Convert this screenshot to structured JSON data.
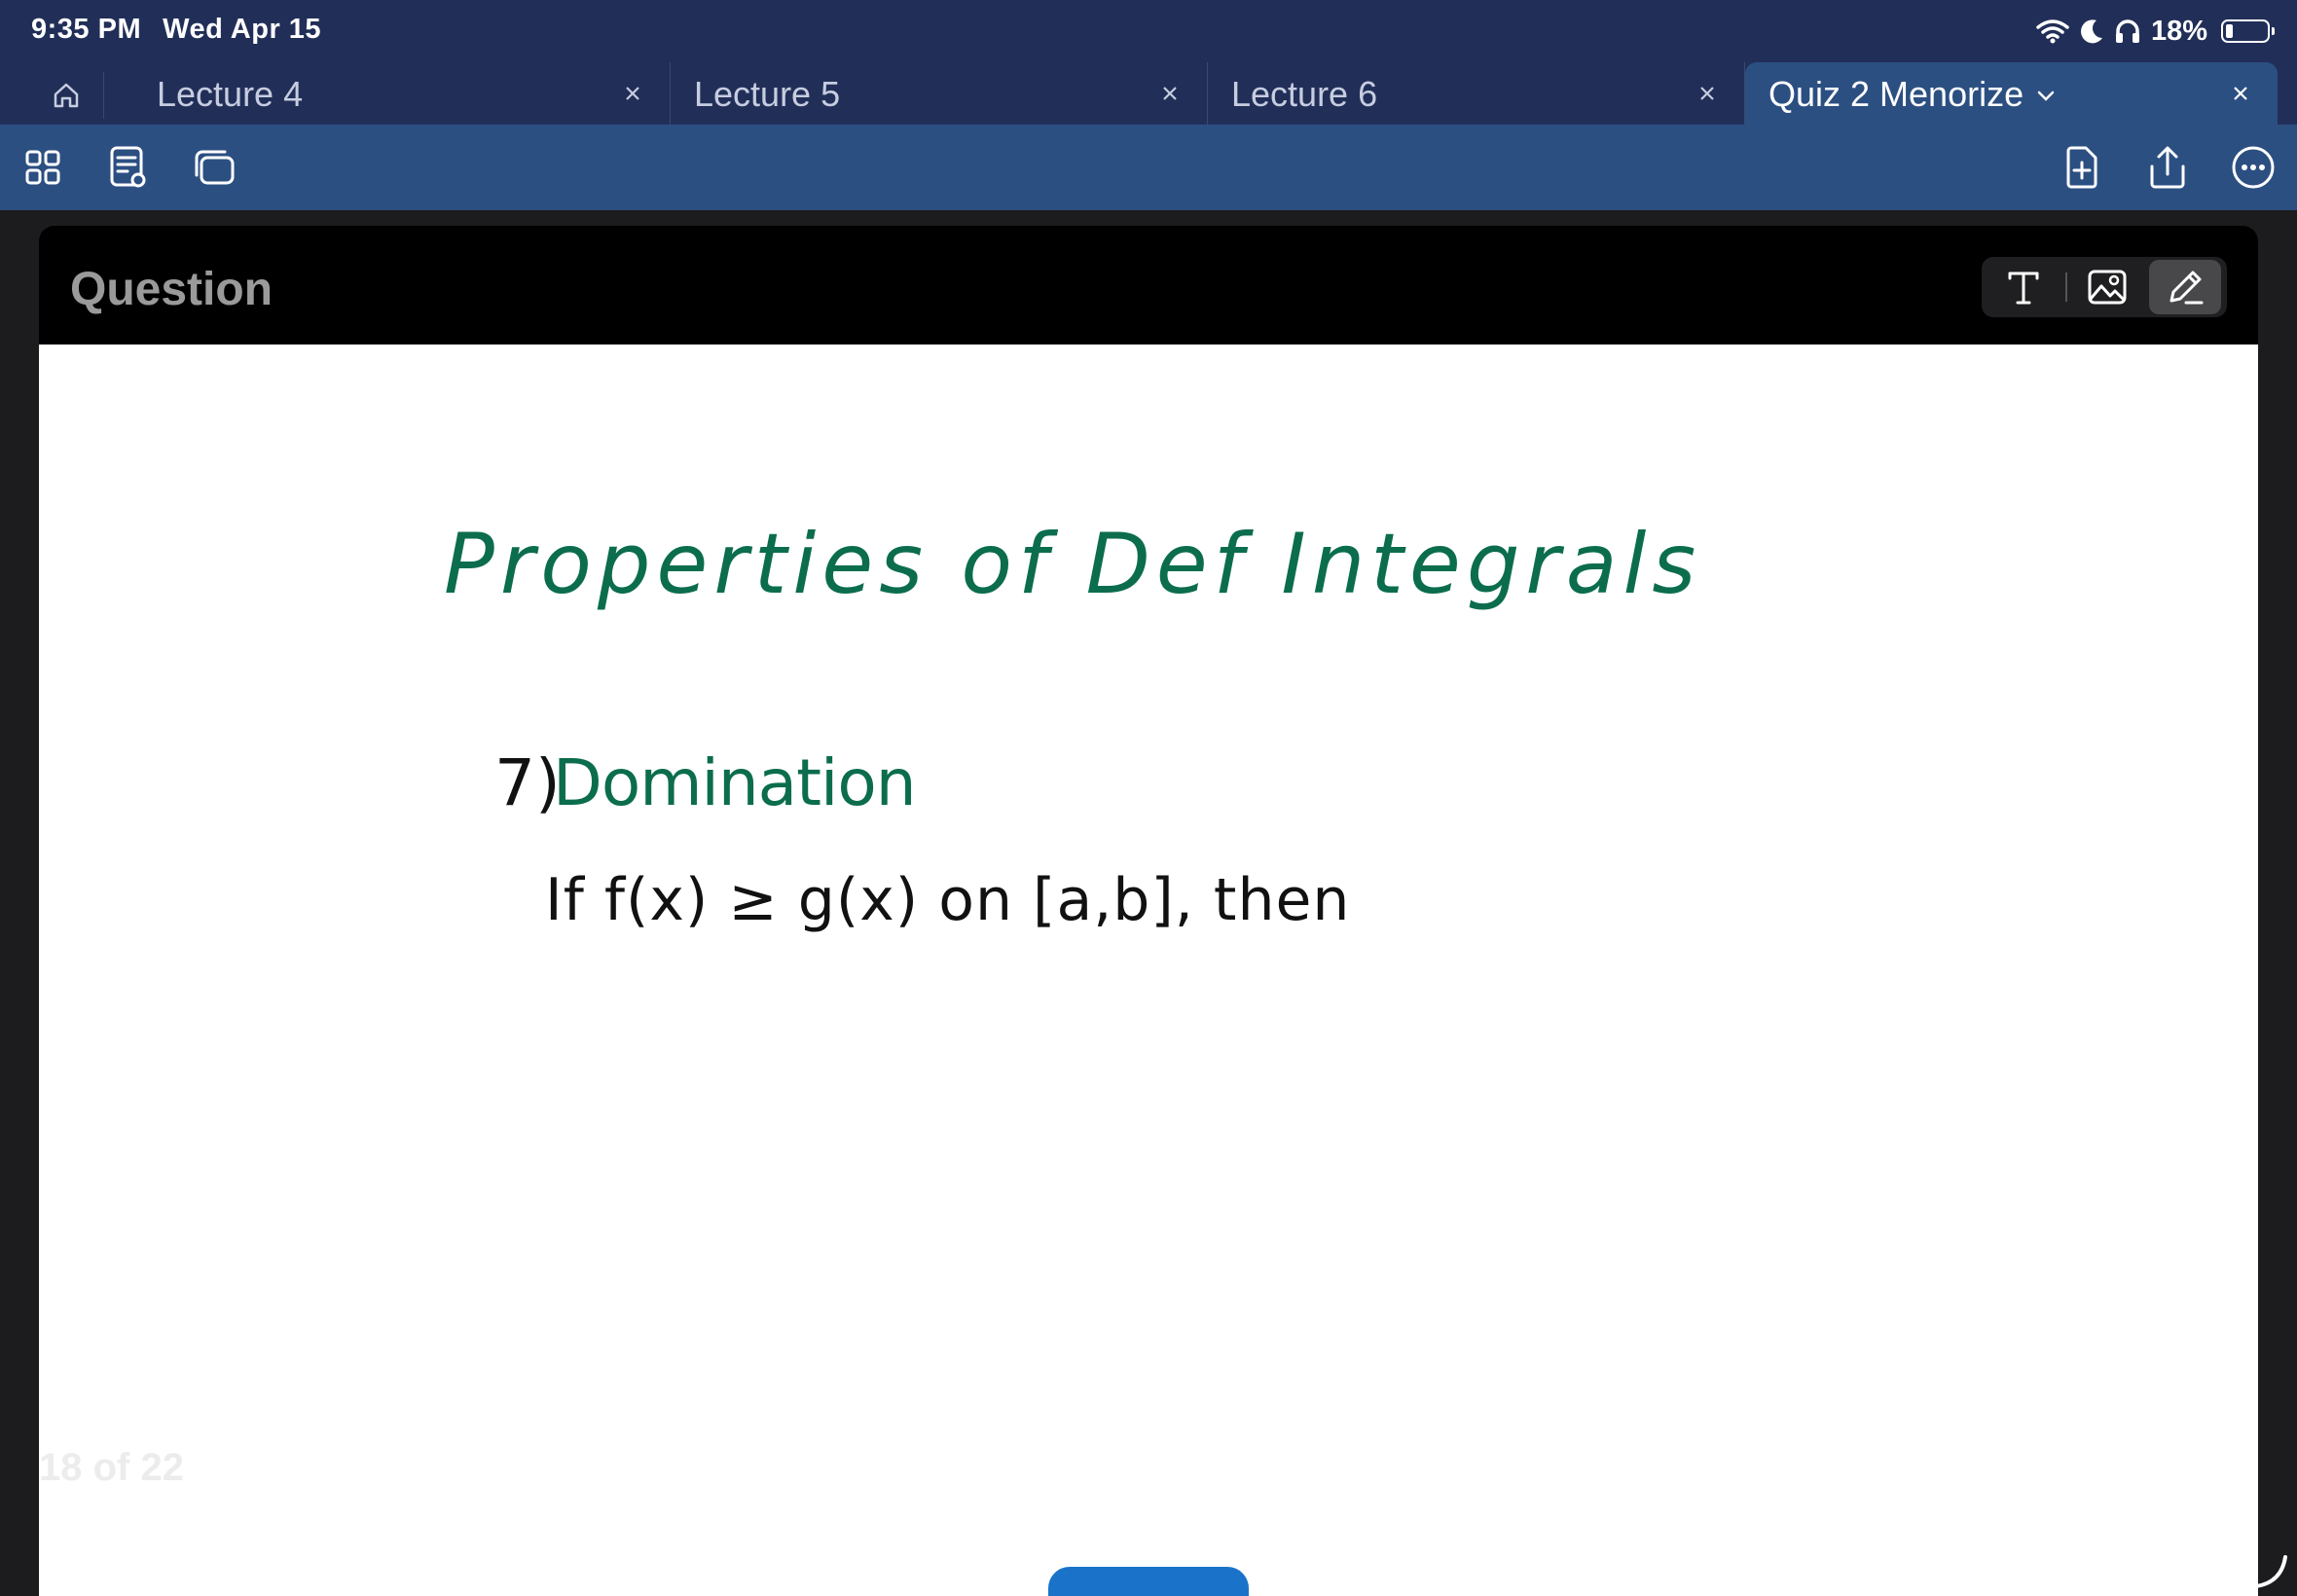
{
  "status_bar": {
    "time": "9:35 PM",
    "date": "Wed Apr 15",
    "battery_percent": "18%",
    "battery_level": 0.18,
    "icons": [
      "wifi-icon",
      "moon-icon",
      "headphones-icon",
      "battery-icon"
    ]
  },
  "tabs": [
    {
      "label": "Lecture 4",
      "active": false
    },
    {
      "label": "Lecture 5",
      "active": false
    },
    {
      "label": "Lecture 6",
      "active": false
    },
    {
      "label": "Quiz 2 Menorize",
      "active": true
    }
  ],
  "toolbar": {
    "left_icons": [
      "grid-icon",
      "note-preview-icon",
      "cards-icon"
    ],
    "right_icons": [
      "add-page-icon",
      "share-icon",
      "more-icon"
    ]
  },
  "card": {
    "header_title": "Question",
    "tools": [
      "text-tool-icon",
      "image-tool-icon",
      "pen-tool-icon"
    ],
    "active_tool": "pen-tool-icon",
    "handwriting": {
      "title": "Properties of Def Integrals",
      "item_number": "7)",
      "item_title": "Domination",
      "body": "If f(x) ≥ g(x) on [a,b], then"
    },
    "page_counter": "18 of 22"
  },
  "colors": {
    "status_bg": "#212f58",
    "toolbar_bg": "#2c4f82",
    "ink_green": "#0b6d4d",
    "button_blue": "#1a73c9"
  }
}
